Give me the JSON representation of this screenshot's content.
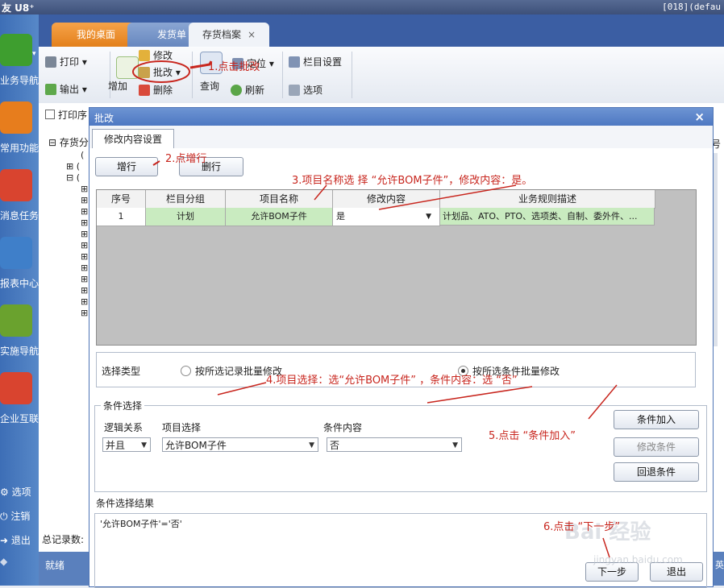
{
  "app": {
    "logo_text": "友 U8⁺",
    "session": "[018](defau"
  },
  "left_nav": {
    "items": [
      {
        "label": "业务导航",
        "icon": "grid-icon",
        "color": "#3e9e2f"
      },
      {
        "label": "常用功能",
        "icon": "star-icon",
        "color": "#e77d1d"
      },
      {
        "label": "消息任务",
        "icon": "envelope-icon",
        "color": "#d9442f"
      },
      {
        "label": "报表中心",
        "icon": "report-icon",
        "color": "#3f7fc9"
      },
      {
        "label": "实施导航",
        "icon": "compass-icon",
        "color": "#6aa22e"
      },
      {
        "label": "企业互联",
        "icon": "connect-icon",
        "color": "#d9442f"
      }
    ],
    "bottom": [
      {
        "label": "选项",
        "icon": "gear-icon"
      },
      {
        "label": "注销",
        "icon": "power-icon"
      },
      {
        "label": "退出",
        "icon": "exit-icon"
      }
    ]
  },
  "tabs": {
    "desktop": "我的桌面",
    "shipping": "发货单",
    "inventory": "存货档案",
    "close_glyph": "×"
  },
  "toolbar": {
    "print": "打印",
    "export": "输出",
    "add": "增加",
    "modify": "修改",
    "batch_modify": "批改",
    "delete": "删除",
    "query": "查询",
    "locate": "定位",
    "refresh": "刷新",
    "column_settings": "栏目设置",
    "options": "选项"
  },
  "workspace": {
    "print_seq": "打印序",
    "tree_root": "存货分",
    "total_label": "总记录数:",
    "col_hint": "号"
  },
  "status": {
    "ready": "就绪",
    "right": "英"
  },
  "dialog": {
    "title": "批改",
    "tab": "修改内容设置",
    "add_row": "增行",
    "delete_row": "删行",
    "grid": {
      "headers": [
        "序号",
        "栏目分组",
        "项目名称",
        "修改内容",
        "业务规则描述"
      ],
      "rows": [
        {
          "seq": "1",
          "group": "计划",
          "item": "允许BOM子件",
          "value": "是",
          "rule": "计划品、ATO、PTO、选项类、自制、委外件、..."
        }
      ]
    },
    "select_type_label": "选择类型",
    "radio_records": "按所选记录批量修改",
    "radio_conditions": "按所选条件批量修改",
    "radio_selected": "conditions",
    "condition_group_label": "条件选择",
    "logic_label": "逻辑关系",
    "logic_value": "并且",
    "item_select_label": "项目选择",
    "item_select_value": "允许BOM子件",
    "cond_content_label": "条件内容",
    "cond_content_value": "否",
    "btn_add_condition": "条件加入",
    "btn_modify_condition": "修改条件",
    "btn_remove_condition": "回退条件",
    "result_label": "条件选择结果",
    "result_text": "'允许BOM子件'='否'",
    "btn_next": "下一步",
    "btn_exit": "退出"
  },
  "annotations": {
    "a1": "1.点击批改",
    "a2": "2.点增行",
    "a3": "3.项目名称选 择 “允许BOM子件”，修改内容：是。",
    "a4": "4.项目选择：选“允许BOM子件”  ，条件内容：选 “否”",
    "a5": "5.点击 “条件加入”",
    "a6": "6.点击 “下一步”",
    "color": "#c8261e"
  },
  "watermark": {
    "text": "Bai 经验",
    "url": "jingyan.baidu.com"
  }
}
